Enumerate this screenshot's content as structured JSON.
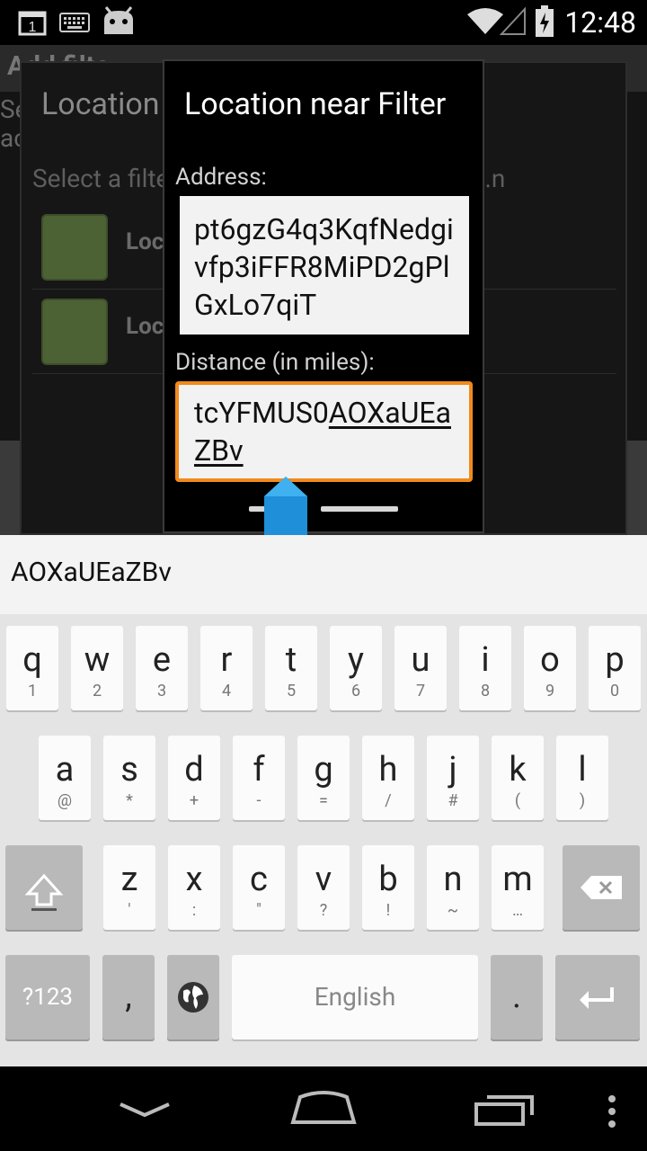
{
  "status_bar": {
    "time": "12:48",
    "notification_count": "1"
  },
  "background_app": {
    "actionbar_title": "Add filte",
    "body_text": "Se\nac"
  },
  "dialog_behind": {
    "title": "Location",
    "prompt": "Select a filter to apply to [Location]: Loc...n",
    "items": [
      {
        "label": "Location near"
      },
      {
        "label": "Location area"
      }
    ]
  },
  "dialog": {
    "title": "Location near Filter",
    "address_label": "Address:",
    "address_value": "pt6gzG4q3KqfNedgivfp3iFFR8MiPD2gPlGxLo7qiT",
    "distance_label": "Distance (in miles):",
    "distance_value_plain": "tcYFMUS0",
    "distance_value_composing": "AOXaUEaZBv"
  },
  "suggestion": {
    "text": "AOXaUEaZBv"
  },
  "keyboard": {
    "row1": [
      {
        "k": "q",
        "s": "1"
      },
      {
        "k": "w",
        "s": "2"
      },
      {
        "k": "e",
        "s": "3"
      },
      {
        "k": "r",
        "s": "4"
      },
      {
        "k": "t",
        "s": "5"
      },
      {
        "k": "y",
        "s": "6"
      },
      {
        "k": "u",
        "s": "7"
      },
      {
        "k": "i",
        "s": "8"
      },
      {
        "k": "o",
        "s": "9"
      },
      {
        "k": "p",
        "s": "0"
      }
    ],
    "row2": [
      {
        "k": "a",
        "s": "@"
      },
      {
        "k": "s",
        "s": "*"
      },
      {
        "k": "d",
        "s": "+"
      },
      {
        "k": "f",
        "s": "-"
      },
      {
        "k": "g",
        "s": "="
      },
      {
        "k": "h",
        "s": "/"
      },
      {
        "k": "j",
        "s": "#"
      },
      {
        "k": "k",
        "s": "("
      },
      {
        "k": "l",
        "s": ")"
      }
    ],
    "row3": [
      {
        "k": "z",
        "s": "'"
      },
      {
        "k": "x",
        "s": ":"
      },
      {
        "k": "c",
        "s": "\""
      },
      {
        "k": "v",
        "s": "?"
      },
      {
        "k": "b",
        "s": "!"
      },
      {
        "k": "n",
        "s": "~"
      },
      {
        "k": "m",
        "s": "…"
      }
    ],
    "symbols_label": "?123",
    "comma_label": ",",
    "space_label": "English",
    "period_label": "."
  }
}
